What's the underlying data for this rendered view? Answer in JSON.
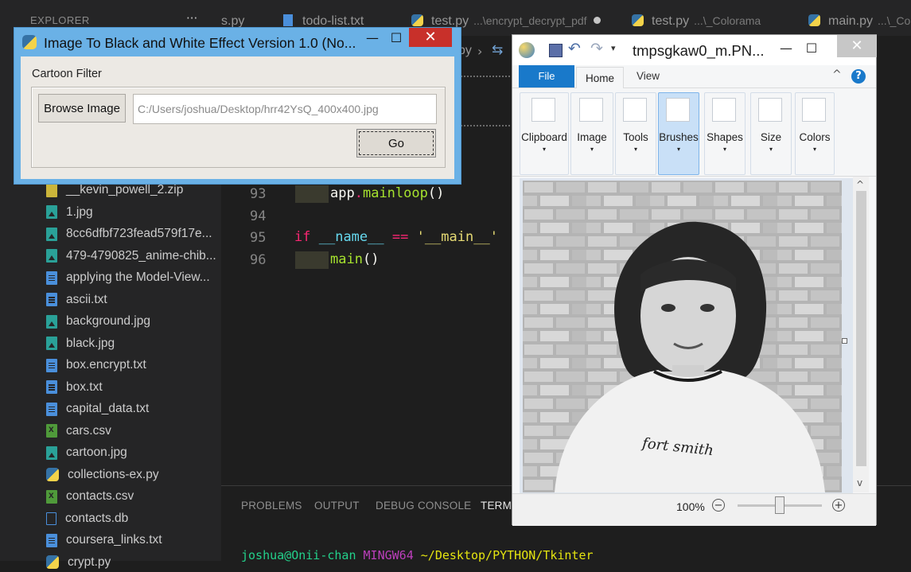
{
  "explorer": {
    "header": "EXPLORER",
    "more": "···",
    "files": [
      {
        "name": "__kevin_powell_2.zip",
        "type": "zip"
      },
      {
        "name": "1.jpg",
        "type": "img"
      },
      {
        "name": "8cc6dfbf723fead579f17e...",
        "type": "img"
      },
      {
        "name": "479-4790825_anime-chib...",
        "type": "img"
      },
      {
        "name": "applying the Model-View...",
        "type": "txt"
      },
      {
        "name": "ascii.txt",
        "type": "txt"
      },
      {
        "name": "background.jpg",
        "type": "img"
      },
      {
        "name": "black.jpg",
        "type": "img"
      },
      {
        "name": "box.encrypt.txt",
        "type": "txt"
      },
      {
        "name": "box.txt",
        "type": "txt"
      },
      {
        "name": "capital_data.txt",
        "type": "txt"
      },
      {
        "name": "cars.csv",
        "type": "csv"
      },
      {
        "name": "cartoon.jpg",
        "type": "img"
      },
      {
        "name": "collections-ex.py",
        "type": "py"
      },
      {
        "name": "contacts.csv",
        "type": "csv"
      },
      {
        "name": "contacts.db",
        "type": "db"
      },
      {
        "name": "coursera_links.txt",
        "type": "txt"
      },
      {
        "name": "crypt.py",
        "type": "py"
      }
    ]
  },
  "tabs": [
    {
      "name": "s.py"
    },
    {
      "name": "todo-list.txt"
    },
    {
      "name": "test.py",
      "path": "...\\encrypt_decrypt_pdf"
    },
    {
      "name": "test.py",
      "path": "...\\_Colorama"
    },
    {
      "name": "main.py",
      "path": "...\\_Co"
    }
  ],
  "editor": {
    "breadcrumb_tail": "py",
    "lines": [
      {
        "n": "93",
        "code": "app.mainloop()"
      },
      {
        "n": "94",
        "code": ""
      },
      {
        "n": "95",
        "code": "if __name__ == '__main__'"
      },
      {
        "n": "96",
        "code": "main()"
      }
    ],
    "code": {
      "app": "app",
      "dot": ".",
      "mainloop": "mainloop",
      "paren": "()",
      "if": "if",
      "name_var": "__name__",
      "eq": " == ",
      "main_str": "'__main__'",
      "main": "main"
    }
  },
  "panel": {
    "tabs": [
      "PROBLEMS",
      "OUTPUT",
      "DEBUG CONSOLE",
      "TERMI"
    ],
    "terminal": {
      "user": "joshua@Onii-chan",
      "env": "MINGW64",
      "cwd": "~/Desktop/PYTHON/Tkinter"
    }
  },
  "tk_window": {
    "title": "Image To Black and White Effect Version 1.0 (No...",
    "minimize": "—",
    "maximize": "☐",
    "close": "✕",
    "frame_label": "Cartoon Filter",
    "browse_label": "Browse Image",
    "path_value": "C:/Users/joshua/Desktop/hrr42YsQ_400x400.jpg",
    "go_label": "Go"
  },
  "paint": {
    "title": "tmpsgkaw0_m.PN...",
    "minimize": "—",
    "maximize": "☐",
    "close": "✕",
    "tabs": {
      "file": "File",
      "home": "Home",
      "view": "View"
    },
    "groups": [
      {
        "label": "Clipboard",
        "icon": "clipboard-icon"
      },
      {
        "label": "Image",
        "icon": "select-icon"
      },
      {
        "label": "Tools",
        "icon": "text-tool-icon"
      },
      {
        "label": "Brushes",
        "icon": "brush-icon",
        "selected": true
      },
      {
        "label": "Shapes",
        "icon": "shapes-icon"
      },
      {
        "label": "Size",
        "icon": "size-icon"
      },
      {
        "label": "Colors",
        "icon": "colors-icon"
      }
    ],
    "arrow": "▾",
    "photo_caption": "fort smith",
    "zoom": "100%",
    "zoom_minus": "−",
    "zoom_plus": "+",
    "help": "?",
    "collapse": "^",
    "scroll_up": "^",
    "scroll_down": "v"
  }
}
